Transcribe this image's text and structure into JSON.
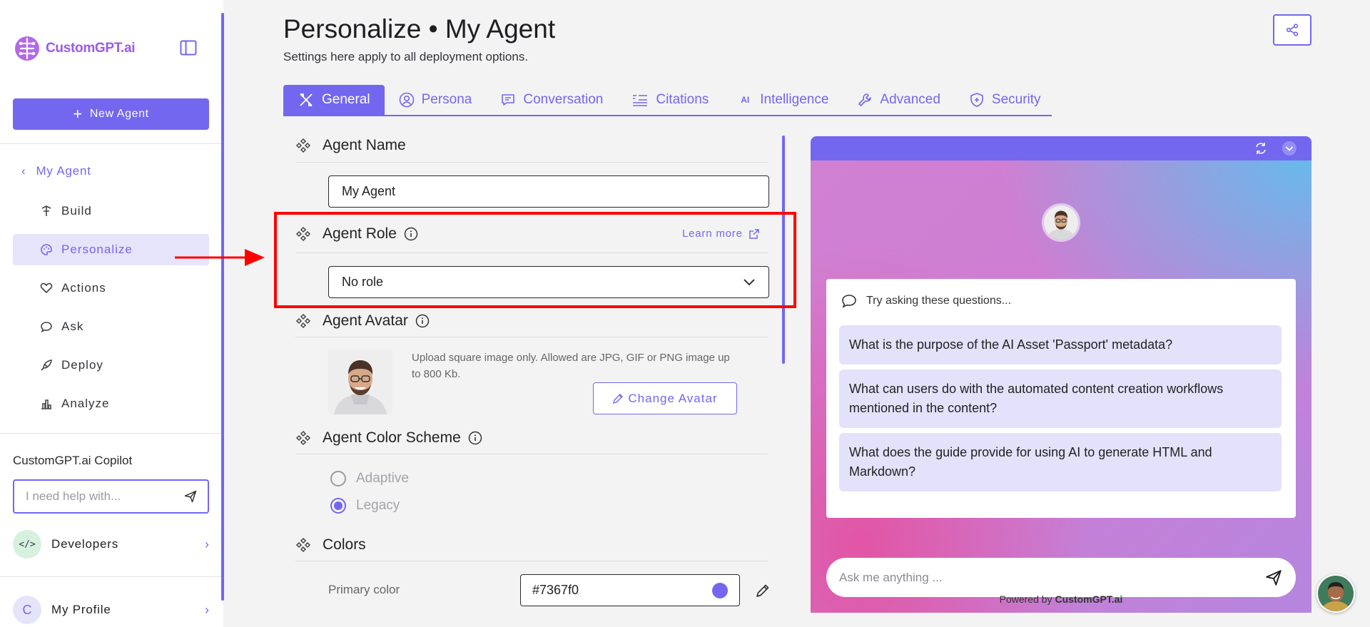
{
  "sidebar": {
    "logo_text": "CustomGPT.ai",
    "new_agent_label": "New Agent",
    "back_label": "My Agent",
    "nav_items": [
      {
        "label": "Build",
        "icon": "build-icon"
      },
      {
        "label": "Personalize",
        "icon": "palette-icon",
        "active": true
      },
      {
        "label": "Actions",
        "icon": "actions-icon"
      },
      {
        "label": "Ask",
        "icon": "chat-icon"
      },
      {
        "label": "Deploy",
        "icon": "rocket-icon"
      },
      {
        "label": "Analyze",
        "icon": "bar-chart-icon"
      }
    ],
    "copilot_title": "CustomGPT.ai Copilot",
    "copilot_placeholder": "I need help with...",
    "developers_icon": "</>",
    "developers_label": "Developers",
    "profile_initial": "C",
    "profile_label": "My Profile"
  },
  "header": {
    "title": "Personalize • My Agent",
    "subtitle": "Settings here apply to all deployment options."
  },
  "tabs": [
    {
      "label": "General",
      "icon": "wrench-cross-icon",
      "active": true
    },
    {
      "label": "Persona",
      "icon": "user-circle-icon"
    },
    {
      "label": "Conversation",
      "icon": "message-icon"
    },
    {
      "label": "Citations",
      "icon": "quote-list-icon"
    },
    {
      "label": "Intelligence",
      "icon": "ai-icon"
    },
    {
      "label": "Advanced",
      "icon": "tool-icon"
    },
    {
      "label": "Security",
      "icon": "shield-icon"
    }
  ],
  "form": {
    "agent_name": {
      "title": "Agent Name",
      "value": "My Agent"
    },
    "agent_role": {
      "title": "Agent Role",
      "learn_more": "Learn more",
      "value": "No role"
    },
    "agent_avatar": {
      "title": "Agent Avatar",
      "note": "Upload square image only. Allowed are JPG, GIF or PNG image up to 800 Kb.",
      "change_label": "Change Avatar"
    },
    "color_scheme": {
      "title": "Agent Color Scheme",
      "options": [
        {
          "label": "Adaptive",
          "checked": false
        },
        {
          "label": "Legacy",
          "checked": true
        }
      ]
    },
    "colors": {
      "title": "Colors",
      "primary_label": "Primary color",
      "primary_value": "#7367f0"
    }
  },
  "ai_icon_text": "AI",
  "preview": {
    "try_asking": "Try asking these questions...",
    "questions": [
      "What is the purpose of the AI Asset 'Passport' metadata?",
      "What can users do with the automated content creation workflows mentioned in the content?",
      "What does the guide provide for using AI to generate HTML and Markdown?"
    ],
    "ask_placeholder": "Ask me anything ...",
    "powered_prefix": "Powered by",
    "powered_brand": "CustomGPT.ai"
  },
  "colors": {
    "accent": "#7367f0",
    "highlight": "#ff0000"
  }
}
